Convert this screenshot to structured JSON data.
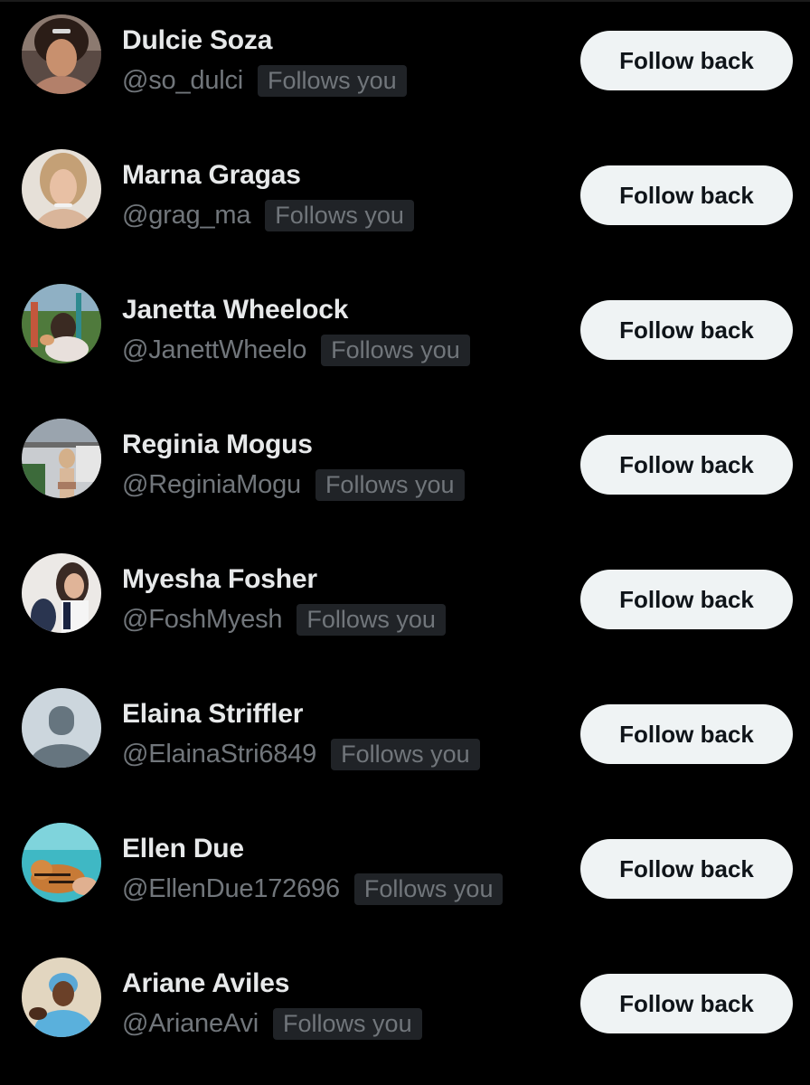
{
  "followers": [
    {
      "name": "Dulcie Soza",
      "handle": "@so_dulci",
      "badge": "Follows you",
      "button": "Follow back",
      "avatar": "photo-avatar"
    },
    {
      "name": "Marna Gragas",
      "handle": "@grag_ma",
      "badge": "Follows you",
      "button": "Follow back",
      "avatar": "photo-avatar"
    },
    {
      "name": "Janetta Wheelock",
      "handle": "@JanettWheelo",
      "badge": "Follows you",
      "button": "Follow back",
      "avatar": "photo-avatar"
    },
    {
      "name": "Reginia Mogus",
      "handle": "@ReginiaMogu",
      "badge": "Follows you",
      "button": "Follow back",
      "avatar": "photo-avatar"
    },
    {
      "name": "Myesha Fosher",
      "handle": "@FoshMyesh",
      "badge": "Follows you",
      "button": "Follow back",
      "avatar": "photo-avatar"
    },
    {
      "name": "Elaina Striffler",
      "handle": "@ElainaStri6849",
      "badge": "Follows you",
      "button": "Follow back",
      "avatar": "default-avatar-icon"
    },
    {
      "name": "Ellen Due",
      "handle": "@EllenDue172696",
      "badge": "Follows you",
      "button": "Follow back",
      "avatar": "photo-avatar"
    },
    {
      "name": "Ariane Aviles",
      "handle": "@ArianeAvi",
      "badge": "Follows you",
      "button": "Follow back",
      "avatar": "photo-avatar"
    }
  ],
  "colors": {
    "background": "#000000",
    "name_text": "#e7e9ea",
    "secondary_text": "#71767b",
    "badge_bg": "#202327",
    "button_bg": "#eff3f4",
    "button_text": "#0f1419"
  }
}
